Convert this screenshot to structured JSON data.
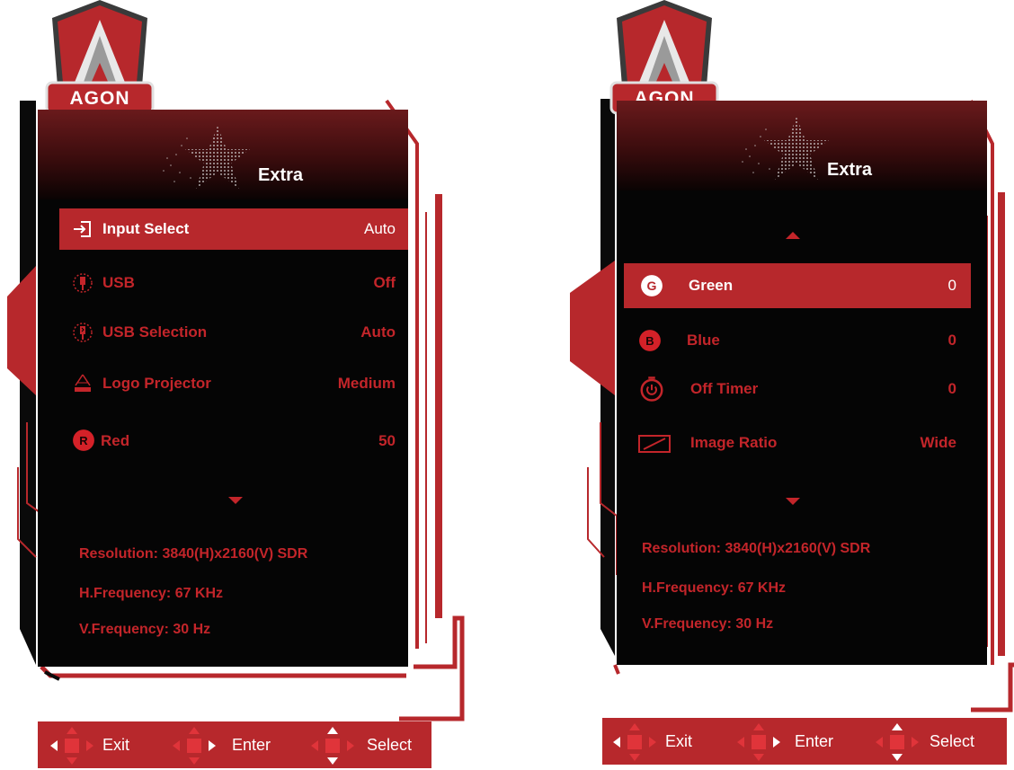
{
  "brand": {
    "logo_text": "AGON"
  },
  "colors": {
    "accent": "#b7282c",
    "text_red": "#c3252a",
    "panel_bg": "#050505",
    "header_dark": "#3a0c0d"
  },
  "left_osd": {
    "title": "Extra",
    "items": [
      {
        "icon": "input-select-icon",
        "label": "Input Select",
        "value": "Auto",
        "selected": true
      },
      {
        "icon": "usb-icon",
        "label": "USB",
        "value": "Off",
        "selected": false
      },
      {
        "icon": "usb-selection-icon",
        "label": "USB Selection",
        "value": "Auto",
        "selected": false
      },
      {
        "icon": "logo-projector-icon",
        "label": "Logo Projector",
        "value": "Medium",
        "selected": false
      },
      {
        "icon": "red-icon",
        "label": "Red",
        "value": "50",
        "selected": false
      }
    ],
    "resolution": "Resolution: 3840(H)x2160(V) SDR",
    "h_frequency": "H.Frequency: 67 KHz",
    "v_frequency": "V.Frequency: 30 Hz"
  },
  "right_osd": {
    "title": "Extra",
    "items": [
      {
        "icon": "green-icon",
        "label": "Green",
        "value": "0",
        "selected": true
      },
      {
        "icon": "blue-icon",
        "label": "Blue",
        "value": "0",
        "selected": false
      },
      {
        "icon": "off-timer-icon",
        "label": "Off Timer",
        "value": "0",
        "selected": false
      },
      {
        "icon": "image-ratio-icon",
        "label": "Image Ratio",
        "value": "Wide",
        "selected": false
      }
    ],
    "resolution": "Resolution: 3840(H)x2160(V) SDR",
    "h_frequency": "H.Frequency: 67 KHz",
    "v_frequency": "V.Frequency: 30 Hz"
  },
  "footer": {
    "exit_label": "Exit",
    "enter_label": "Enter",
    "select_label": "Select"
  }
}
